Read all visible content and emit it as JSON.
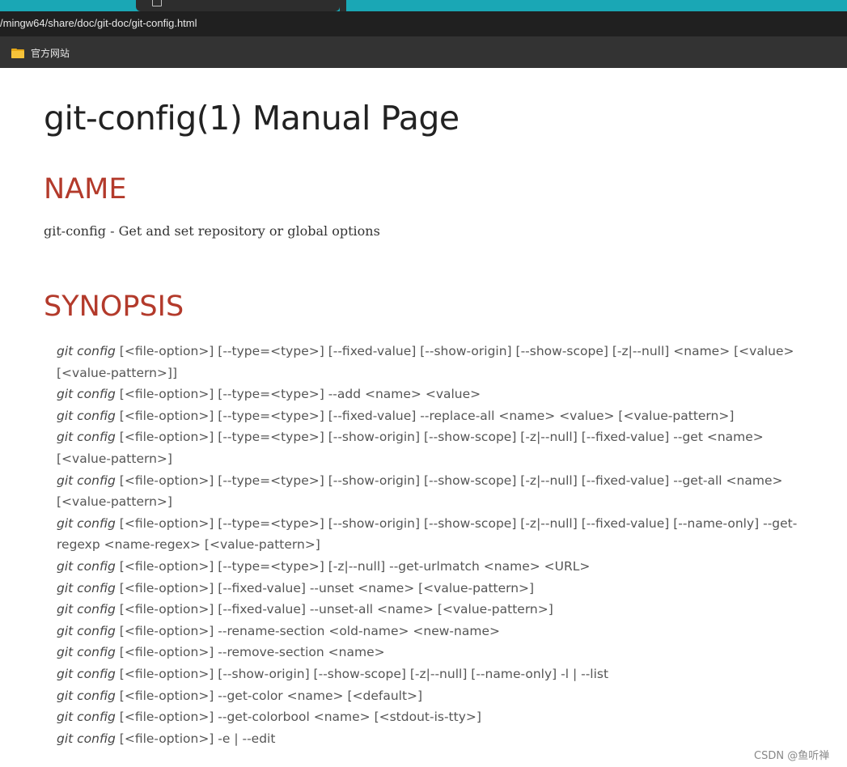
{
  "browser": {
    "url": "/mingw64/share/doc/git-doc/git-config.html",
    "bookmarks": [
      {
        "label": "官方网站",
        "icon": "folder-icon"
      }
    ]
  },
  "page": {
    "title": "git-config(1) Manual Page",
    "sections": {
      "name": {
        "heading": "NAME",
        "text": "git-config - Get and set repository or global options"
      },
      "synopsis": {
        "heading": "SYNOPSIS",
        "command": "git config",
        "lines": [
          {
            "args": "[<file-option>] [--type=<type>] [--fixed-value] [--show-origin] [--show-scope] [-z|--null] <name> [<value> [<value-pattern>]]"
          },
          {
            "args": "[<file-option>] [--type=<type>] --add <name> <value>"
          },
          {
            "args": "[<file-option>] [--type=<type>] [--fixed-value] --replace-all <name> <value> [<value-pattern>]"
          },
          {
            "args": "[<file-option>] [--type=<type>] [--show-origin] [--show-scope] [-z|--null] [--fixed-value] --get <name> [<value-pattern>]"
          },
          {
            "args": "[<file-option>] [--type=<type>] [--show-origin] [--show-scope] [-z|--null] [--fixed-value] --get-all <name> [<value-pattern>]"
          },
          {
            "args": "[<file-option>] [--type=<type>] [--show-origin] [--show-scope] [-z|--null] [--fixed-value] [--name-only] --get-regexp <name-regex> [<value-pattern>]"
          },
          {
            "args": "[<file-option>] [--type=<type>] [-z|--null] --get-urlmatch <name> <URL>"
          },
          {
            "args": "[<file-option>] [--fixed-value] --unset <name> [<value-pattern>]"
          },
          {
            "args": "[<file-option>] [--fixed-value] --unset-all <name> [<value-pattern>]"
          },
          {
            "args": "[<file-option>] --rename-section <old-name> <new-name>"
          },
          {
            "args": "[<file-option>] --remove-section <name>"
          },
          {
            "args": "[<file-option>] [--show-origin] [--show-scope] [-z|--null] [--name-only] -l | --list"
          },
          {
            "args": "[<file-option>] --get-color <name> [<default>]"
          },
          {
            "args": "[<file-option>] --get-colorbool <name> [<stdout-is-tty>]"
          },
          {
            "args": "[<file-option>] -e | --edit"
          }
        ]
      }
    }
  },
  "watermark": "CSDN @鱼听禅",
  "colors": {
    "tab_strip": "#1aa7b5",
    "address_bar": "#202020",
    "bookmarks_bar": "#333333",
    "heading_red": "#b33a2b"
  }
}
